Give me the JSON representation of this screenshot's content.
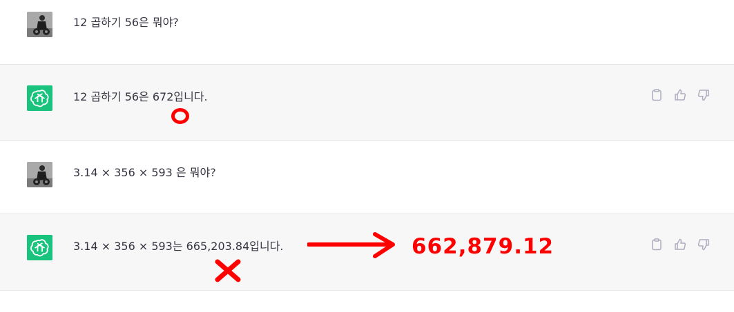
{
  "colors": {
    "assistant_bg": "#f7f7f8",
    "user_bg": "#ffffff",
    "bot_avatar": "#19c37d",
    "annotation_red": "#ff0000",
    "text": "#343541",
    "icon": "#acacbe"
  },
  "messages": [
    {
      "role": "user",
      "avatar": "user-avatar",
      "text": "12 곱하기 56은 뭐야?"
    },
    {
      "role": "assistant",
      "avatar": "chatgpt-logo-icon",
      "text": "12 곱하기 56은 672입니다."
    },
    {
      "role": "user",
      "avatar": "user-avatar",
      "text": "3.14 × 356 × 593 은 뭐야?"
    },
    {
      "role": "assistant",
      "avatar": "chatgpt-logo-icon",
      "text": "3.14 × 356 × 593는 665,203.84입니다."
    }
  ],
  "actions": {
    "icons": [
      "clipboard-icon",
      "thumbs-up-icon",
      "thumbs-down-icon"
    ]
  },
  "annotations": {
    "correct_mark": "O",
    "wrong_mark": "X",
    "correct_answer": "662,879.12"
  }
}
